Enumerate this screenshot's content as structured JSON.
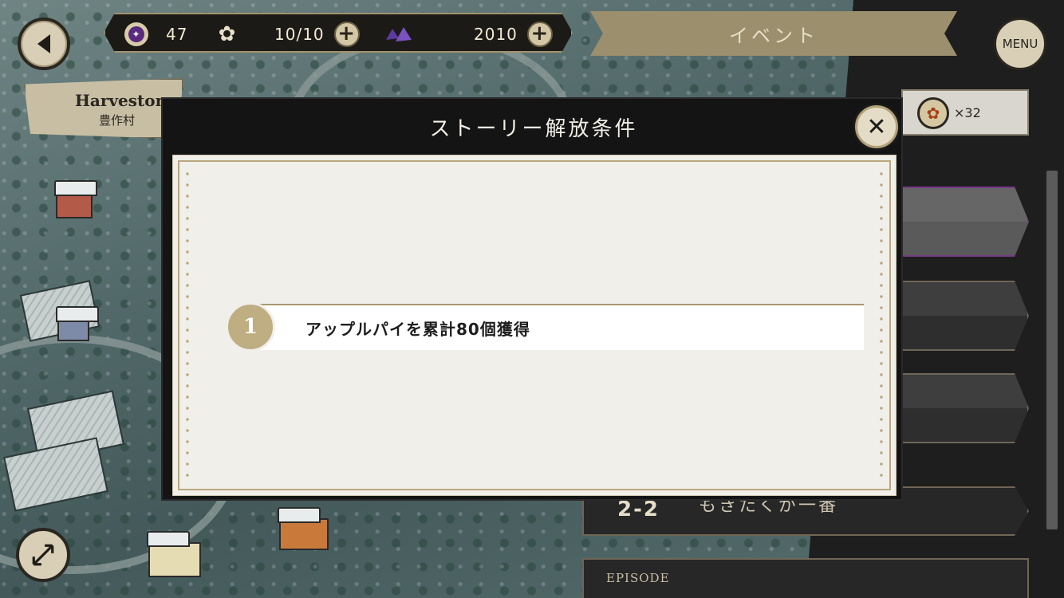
{
  "hud": {
    "gem_count": "47",
    "stamina": "10/10",
    "crystal_count": "2010",
    "event_label": "イベント",
    "menu_label": "MENU"
  },
  "village_sign": {
    "name": "Harveston",
    "subtitle": "豊作村"
  },
  "item_counter": {
    "count": "×32"
  },
  "episode": {
    "number": "2-2",
    "title": "もきたくが一番",
    "next_label": "EPISODE"
  },
  "modal": {
    "title": "ストーリー解放条件",
    "conditions": [
      {
        "index": "1",
        "text": "アップルパイを累計80個獲得"
      }
    ]
  },
  "colors": {
    "accent_gold": "#bfae82",
    "active_purple": "#7a3a8a"
  }
}
